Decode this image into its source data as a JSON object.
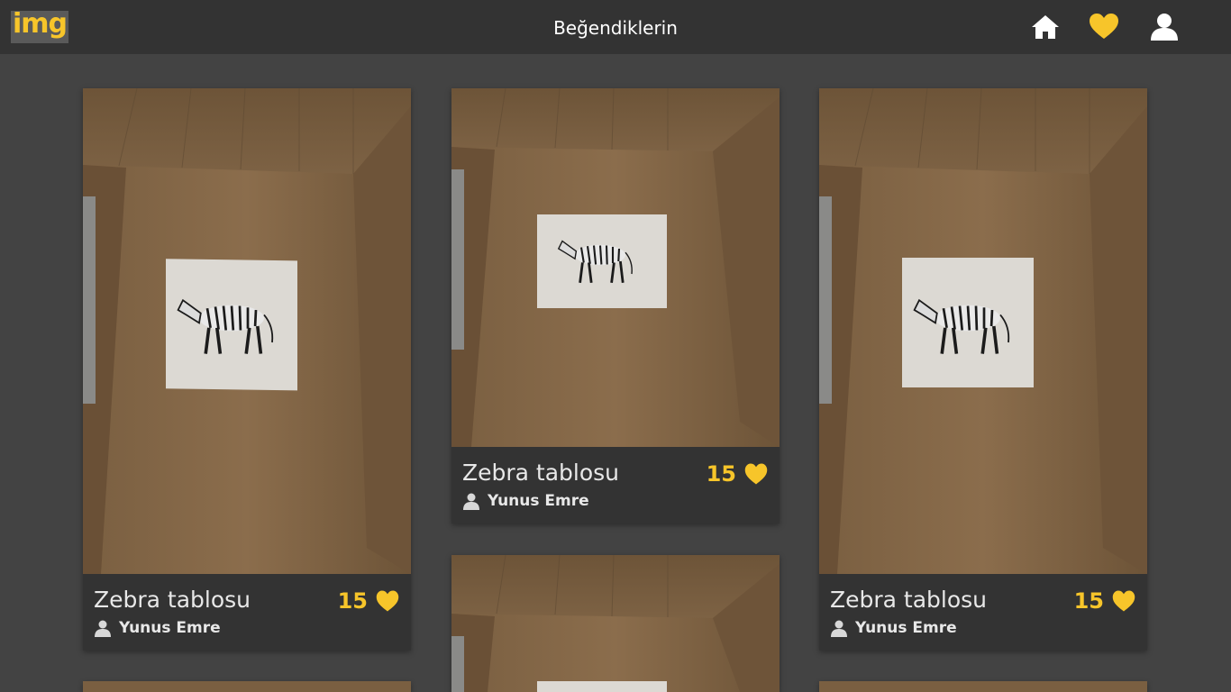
{
  "header": {
    "logo": "img",
    "title": "Beğendiklerin",
    "icons": [
      "home-icon",
      "heart-icon",
      "user-icon"
    ]
  },
  "colors": {
    "accent": "#f7c52a",
    "topbar": "#333333",
    "background": "#434343",
    "card_info": "#333333"
  },
  "cards": [
    {
      "title": "Zebra tablosu",
      "likes": "15",
      "author": "Yunus Emre"
    },
    {
      "title": "Zebra tablosu",
      "likes": "15",
      "author": "Yunus Emre"
    },
    {
      "title": "Zebra tablosu",
      "likes": "15",
      "author": "Yunus Emre"
    },
    {
      "title": "",
      "likes": "",
      "author": ""
    },
    {
      "title": "",
      "likes": "",
      "author": ""
    },
    {
      "title": "",
      "likes": "",
      "author": ""
    }
  ]
}
